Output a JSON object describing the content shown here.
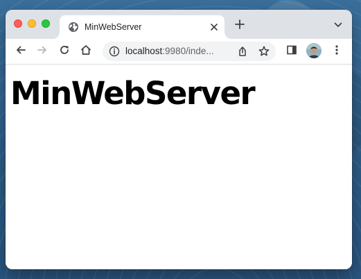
{
  "browser": {
    "tab": {
      "title": "MinWebServer",
      "favicon": "globe-icon"
    },
    "address_bar": {
      "url_host": "localhost",
      "url_rest": ":9980/inde..."
    },
    "icons": {
      "back": "arrow-left-icon",
      "forward": "arrow-right-icon",
      "reload": "reload-icon",
      "home": "home-icon",
      "info": "info-icon",
      "share": "share-icon",
      "bookmark": "star-icon",
      "side_panel": "side-panel-icon",
      "profile": "avatar",
      "menu": "kebab-menu-icon",
      "new_tab": "plus-icon",
      "tab_search": "chevron-down-icon",
      "tab_close": "close-icon"
    }
  },
  "page": {
    "heading": "MinWebServer"
  },
  "colors": {
    "traffic_close": "#ff5f57",
    "traffic_minimize": "#ffbd2e",
    "traffic_maximize": "#28c940",
    "tabstrip": "#dee1e6",
    "omnibox": "#f1f3f4"
  }
}
